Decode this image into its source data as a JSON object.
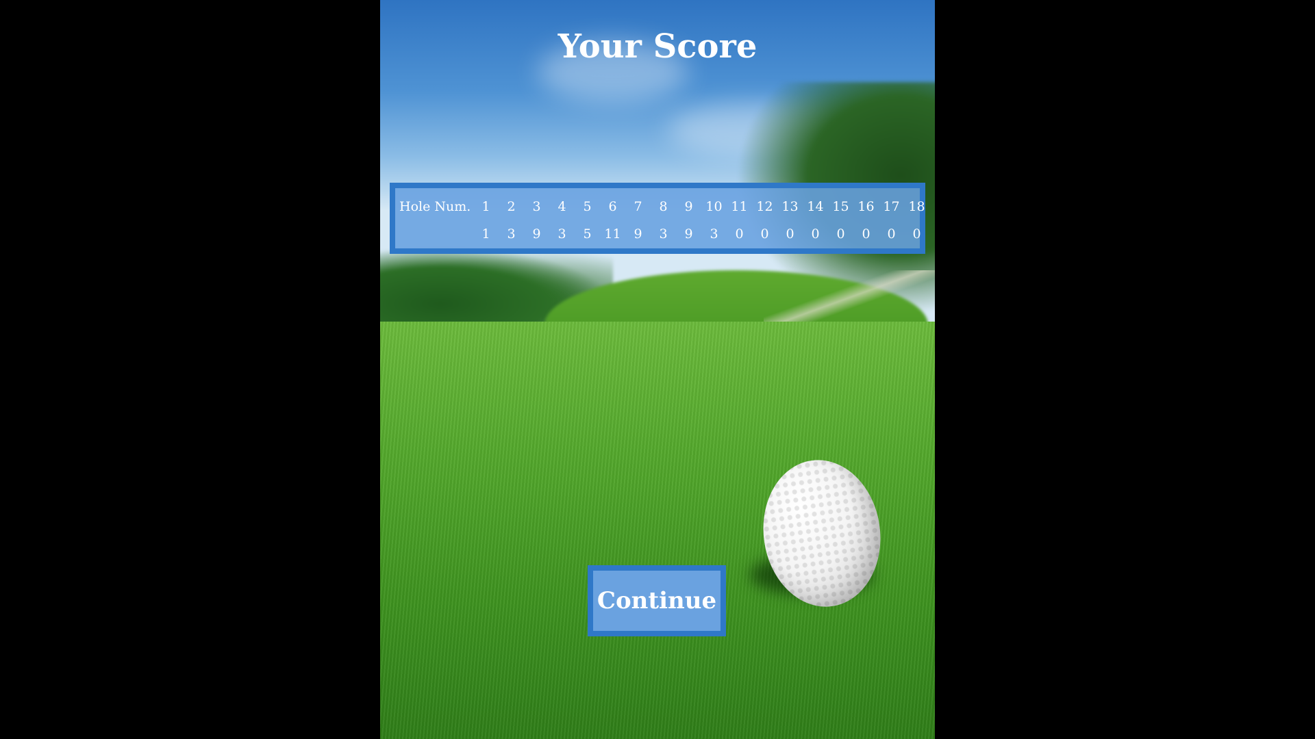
{
  "screen": {
    "title": "Your Score"
  },
  "scorecard": {
    "header_label": "Hole Num.",
    "holes": [
      "1",
      "2",
      "3",
      "4",
      "5",
      "6",
      "7",
      "8",
      "9",
      "10",
      "11",
      "12",
      "13",
      "14",
      "15",
      "16",
      "17",
      "18"
    ],
    "scores": [
      "1",
      "3",
      "9",
      "3",
      "5",
      "11",
      "9",
      "3",
      "9",
      "3",
      "0",
      "0",
      "0",
      "0",
      "0",
      "0",
      "0",
      "0"
    ]
  },
  "actions": {
    "continue_label": "Continue"
  },
  "colors": {
    "panel_border": "#2f78c8",
    "panel_fill": "#68a0e0",
    "text": "#ffffff"
  },
  "background": {
    "scene": "golf-course-with-ball"
  }
}
